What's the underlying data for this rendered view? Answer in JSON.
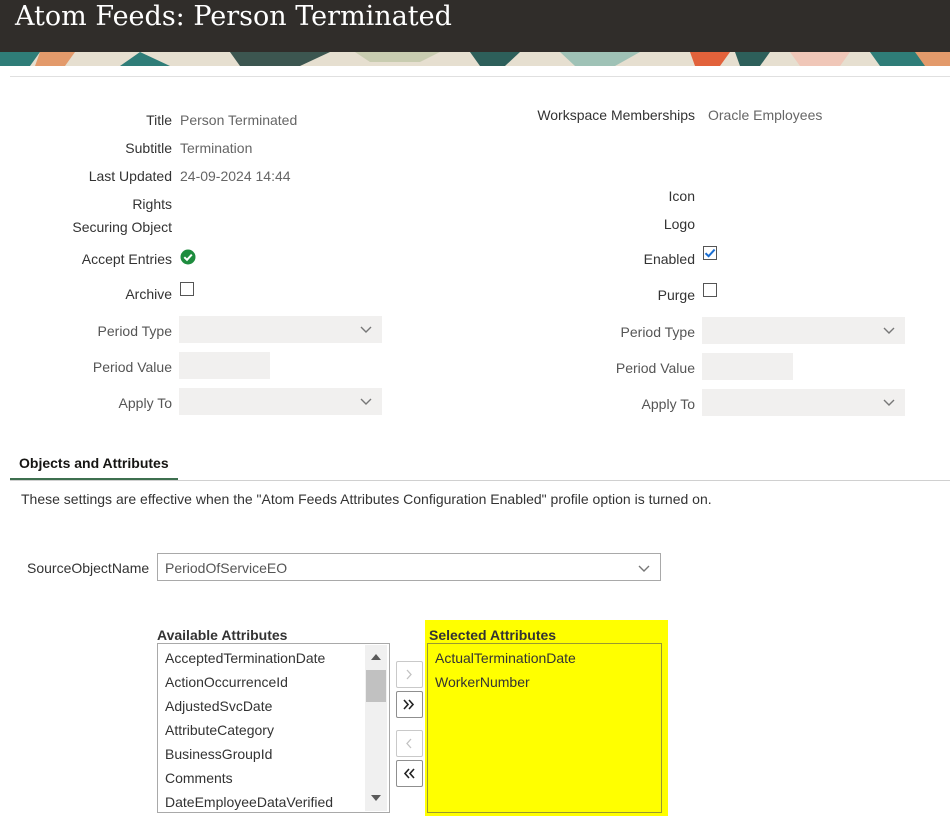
{
  "header": {
    "title": "Atom Feeds: Person Terminated"
  },
  "details_left": {
    "title_label": "Title",
    "title_value": "Person Terminated",
    "subtitle_label": "Subtitle",
    "subtitle_value": "Termination",
    "last_updated_label": "Last Updated",
    "last_updated_value": "24-09-2024 14:44",
    "rights_label": "Rights",
    "securing_object_label": "Securing Object",
    "accept_entries_label": "Accept Entries",
    "accept_entries_value": true,
    "archive_label": "Archive",
    "archive_checked": false,
    "period_type_label": "Period Type",
    "period_type_value": "",
    "period_value_label": "Period Value",
    "period_value_value": "",
    "apply_to_label": "Apply To",
    "apply_to_value": ""
  },
  "details_right": {
    "workspace_label": "Workspace Memberships",
    "workspace_value": "Oracle Employees",
    "icon_label": "Icon",
    "logo_label": "Logo",
    "enabled_label": "Enabled",
    "enabled_checked": true,
    "purge_label": "Purge",
    "purge_checked": false,
    "period_type_label": "Period Type",
    "period_type_value": "",
    "period_value_label": "Period Value",
    "period_value_value": "",
    "apply_to_label": "Apply To",
    "apply_to_value": ""
  },
  "tabs": {
    "active_label": "Objects and Attributes"
  },
  "note": "These settings are effective when the \"Atom Feeds Attributes Configuration Enabled\" profile option is turned on.",
  "source": {
    "label": "SourceObjectName",
    "value": "PeriodOfServiceEO"
  },
  "available": {
    "heading": "Available Attributes",
    "items": [
      "AcceptedTerminationDate",
      "ActionOccurrenceId",
      "AdjustedSvcDate",
      "AttributeCategory",
      "BusinessGroupId",
      "Comments",
      "DateEmployeeDataVerified"
    ]
  },
  "selected": {
    "heading": "Selected Attributes",
    "items": [
      "ActualTerminationDate",
      "WorkerNumber"
    ]
  },
  "shuttle": {
    "move": ">",
    "move_all": "»",
    "remove": "<",
    "remove_all": "«"
  },
  "colors": {
    "header_bg": "#302d2a",
    "tab_underline": "#3e6f4f",
    "highlight": "#ffff00",
    "success_icon": "#1e8c3e",
    "checkbox_checked": "#1a6ed2"
  }
}
